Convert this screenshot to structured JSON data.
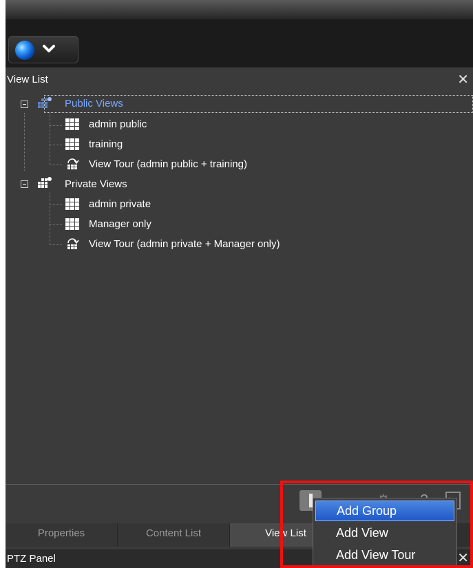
{
  "app": {
    "globe_menu": {
      "icon": "globe-icon",
      "chevron": "chevron-down-icon"
    }
  },
  "view_list": {
    "title": "View List",
    "close_label": "✕",
    "groups": [
      {
        "label": "Public Views",
        "selected": true,
        "items": [
          {
            "label": "admin public",
            "icon": "view-grid-icon"
          },
          {
            "label": "training",
            "icon": "view-grid-icon"
          },
          {
            "label": "View Tour (admin public + training)",
            "icon": "view-tour-icon"
          }
        ]
      },
      {
        "label": "Private Views",
        "selected": false,
        "items": [
          {
            "label": "admin private",
            "icon": "view-grid-icon"
          },
          {
            "label": "Manager only",
            "icon": "view-grid-icon"
          },
          {
            "label": "View Tour (admin private + Manager only)",
            "icon": "view-tour-icon"
          }
        ]
      }
    ]
  },
  "toolbar": {
    "add_icon": "plus-icon",
    "settings_icon": "gear-icon",
    "help_icon": "help-icon",
    "export_icon": "export-icon"
  },
  "tabs": [
    {
      "label": "Properties",
      "active": false
    },
    {
      "label": "Content List",
      "active": false
    },
    {
      "label": "View List",
      "active": true
    }
  ],
  "ptz_panel": {
    "title": "PTZ Panel",
    "close_label": "✕"
  },
  "context_menu": {
    "items": [
      {
        "label": "Add Group",
        "highlighted": true
      },
      {
        "label": "Add View",
        "highlighted": false
      },
      {
        "label": "Add View Tour",
        "highlighted": false
      }
    ]
  },
  "colors": {
    "highlight": "#f01010",
    "selected_text": "#7aa6ff",
    "menu_highlight": "#2f6ad6"
  }
}
